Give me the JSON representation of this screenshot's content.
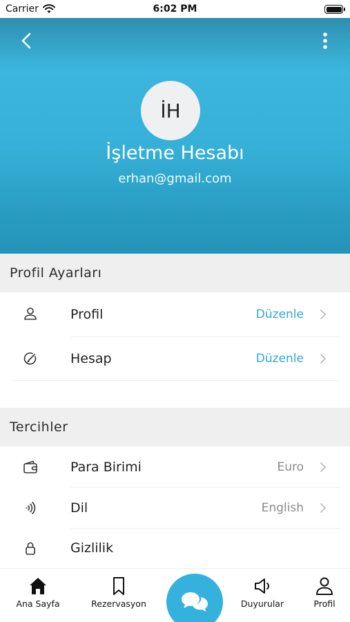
{
  "status_bar": {
    "carrier": "Carrier",
    "time": "6:02 PM"
  },
  "profile": {
    "initials": "İH",
    "name": "İşletme Hesabı",
    "email": "erhan@gmail.com"
  },
  "sections": {
    "profile_settings": {
      "title": "Profil Ayarları",
      "items": [
        {
          "label": "Profil",
          "value": "Düzenle",
          "icon": "user-icon"
        },
        {
          "label": "Hesap",
          "value": "Düzenle",
          "icon": "account-edit-icon"
        }
      ]
    },
    "preferences": {
      "title": "Tercihler",
      "items": [
        {
          "label": "Para Birimi",
          "value": "Euro",
          "icon": "wallet-icon"
        },
        {
          "label": "Dil",
          "value": "English",
          "icon": "sound-wave-icon"
        },
        {
          "label": "Gizlilik",
          "icon": "lock-icon"
        }
      ]
    }
  },
  "tabbar": {
    "home": "Ana Sayfa",
    "reservations": "Rezervasyon",
    "announcements": "Duyurular",
    "profile": "Profil"
  },
  "colors": {
    "accent": "#34b1dd",
    "header_top": "#2e8fae",
    "header_mid": "#3cb6df",
    "header_bottom": "#2493b8",
    "section_bg": "#efefef",
    "link": "#2fa8d3"
  }
}
